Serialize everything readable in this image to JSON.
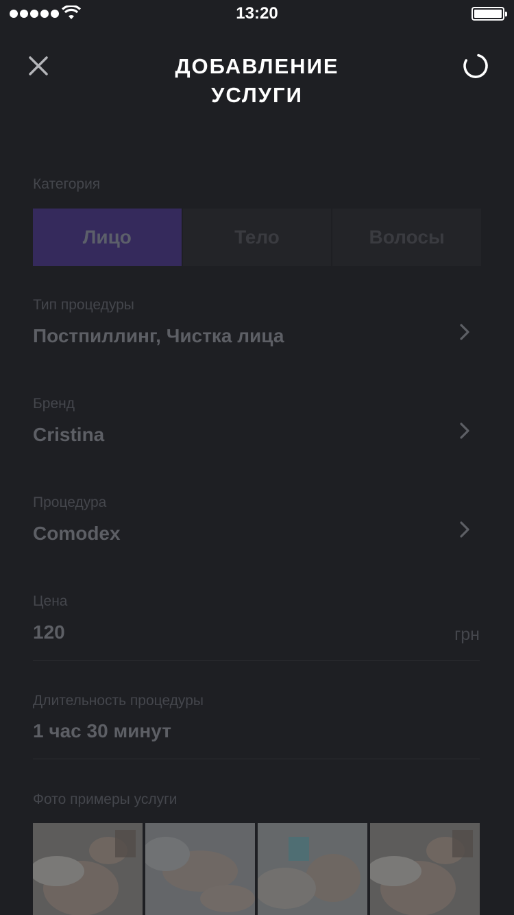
{
  "status_bar": {
    "time": "13:20"
  },
  "header": {
    "title": "ДОБАВЛЕНИЕ\nУСЛУГИ"
  },
  "category": {
    "label": "Категория",
    "options": [
      "Лицо",
      "Тело",
      "Волосы"
    ],
    "selected": "Лицо"
  },
  "procedure_type": {
    "label": "Тип процедуры",
    "value": "Постпиллинг, Чистка лица"
  },
  "brand": {
    "label": "Бренд",
    "value": "Cristina"
  },
  "procedure": {
    "label": "Процедура",
    "value": "Comodex"
  },
  "price": {
    "label": "Цена",
    "value": "120",
    "unit": "грн"
  },
  "duration": {
    "label": "Длительность процедуры",
    "value": "1 час 30 минут"
  },
  "photos": {
    "label": "Фото примеры услуги",
    "count": 4
  },
  "colors": {
    "background": "#1e1f23",
    "accent": "#352a5c",
    "text_dim": "#5d5f65"
  }
}
